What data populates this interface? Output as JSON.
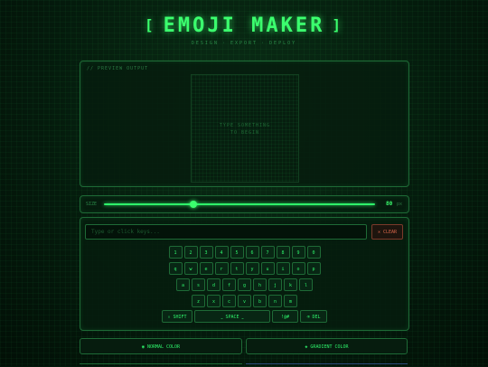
{
  "header": {
    "bracket_left": "[",
    "title": "EMOJI MAKER",
    "bracket_right": "]",
    "subtitle": [
      "DESIGN",
      "EXPORT",
      "DEPLOY"
    ]
  },
  "preview": {
    "label": "// PREVIEW OUTPUT",
    "hint_line1": "TYPE SOMETHING",
    "hint_line2": "TO BEGIN"
  },
  "size": {
    "label": "SIZE",
    "value": "80",
    "unit": "px",
    "slider_fraction": 0.33
  },
  "input": {
    "placeholder": "Type or click keys...",
    "clear_label": "✕ CLEAR"
  },
  "keyboard": {
    "row1": [
      "1",
      "2",
      "3",
      "4",
      "5",
      "6",
      "7",
      "8",
      "9",
      "0"
    ],
    "row2": [
      "q",
      "w",
      "e",
      "r",
      "t",
      "y",
      "u",
      "i",
      "o",
      "p"
    ],
    "row3": [
      "a",
      "s",
      "d",
      "f",
      "g",
      "h",
      "j",
      "k",
      "l"
    ],
    "row4": [
      "z",
      "x",
      "c",
      "v",
      "b",
      "n",
      "m"
    ],
    "shift_label": "⇧ SHIFT",
    "space_label": "⎵ SPACE ⎵",
    "sym_label": "!@#",
    "del_label": "⌫ DEL"
  },
  "modes": {
    "normal_label": "◉ NORMAL COLOR",
    "gradient_label": "◈ GRADIENT COLOR"
  },
  "colors": {
    "accent": "#2ef26a",
    "background": "#041a0c",
    "danger": "#d8664a"
  }
}
